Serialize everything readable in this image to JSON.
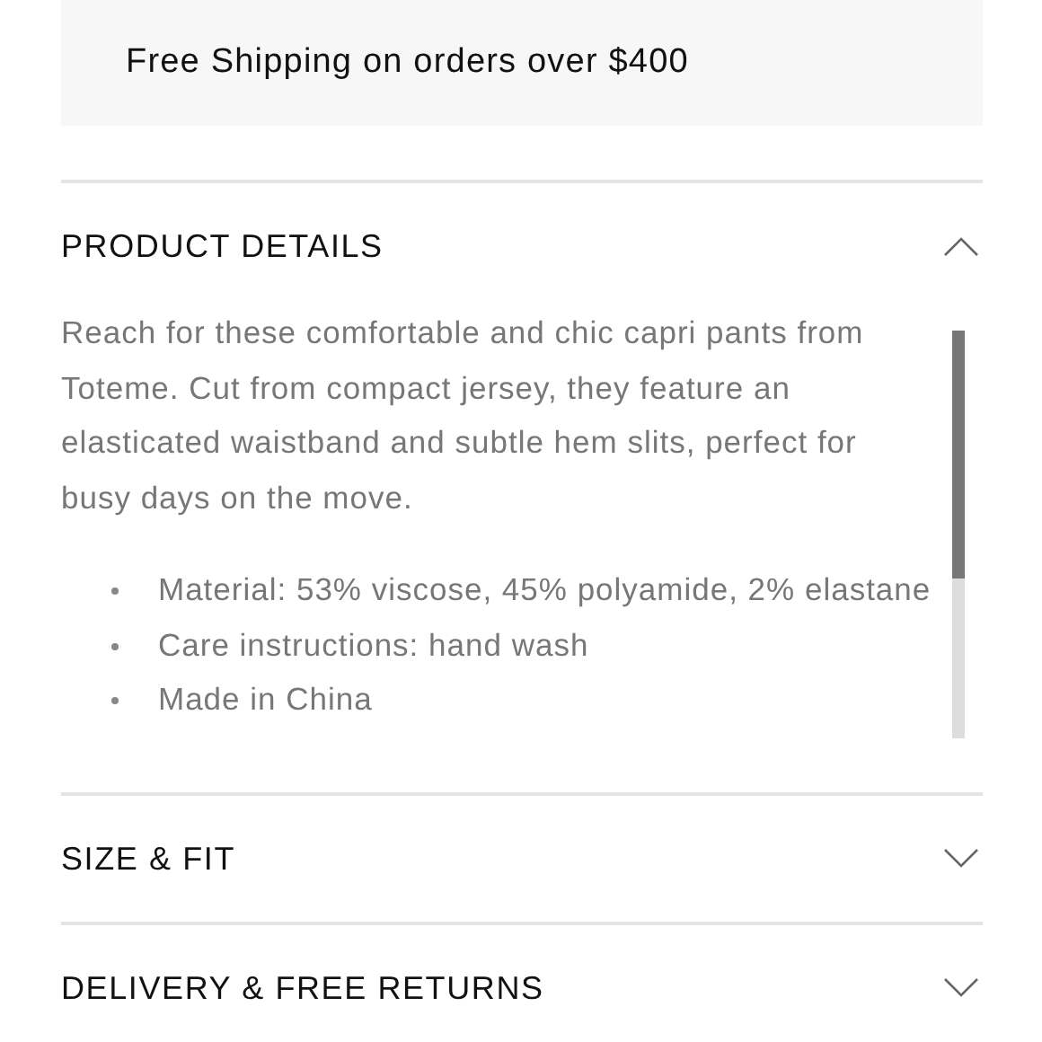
{
  "promo_banner": {
    "text": "Free Shipping on orders over $400"
  },
  "sections": [
    {
      "title": "PRODUCT DETAILS",
      "expanded": true,
      "description": "Reach for these comfortable and chic capri pants from Toteme. Cut from compact jersey, they feature an elasticated waistband and subtle hem slits, perfect for busy days on the move.",
      "bullets": [
        "Material: 53% viscose, 45% polyamide, 2% elastane",
        "Care instructions: hand wash",
        "Made in China"
      ]
    },
    {
      "title": "SIZE & FIT",
      "expanded": false
    },
    {
      "title": "DELIVERY & FREE RETURNS",
      "expanded": false
    }
  ]
}
